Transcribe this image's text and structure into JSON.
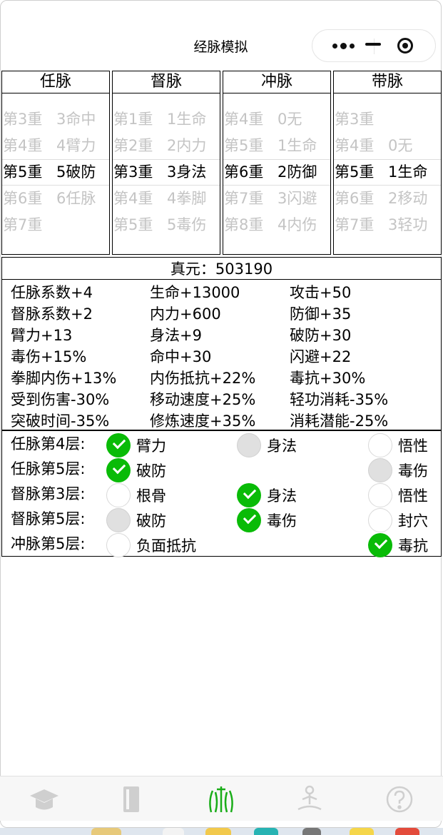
{
  "window": {
    "title": "经脉模拟"
  },
  "capsule": {
    "more_icon": "more-dots-icon",
    "minimize_icon": "minimize-icon",
    "close_icon": "target-close-icon"
  },
  "pickers": [
    {
      "name": "任脉",
      "rows": [
        {
          "lv": "第3重",
          "val": "3命中",
          "state": "dim"
        },
        {
          "lv": "第4重",
          "val": "4臂力",
          "state": "dim"
        },
        {
          "lv": "第5重",
          "val": "5破防",
          "state": "sel"
        },
        {
          "lv": "第6重",
          "val": "6任脉",
          "state": "dim"
        },
        {
          "lv": "第7重",
          "val": "",
          "state": "dim"
        }
      ]
    },
    {
      "name": "督脉",
      "rows": [
        {
          "lv": "第1重",
          "val": "1生命",
          "state": "dim"
        },
        {
          "lv": "第2重",
          "val": "2内力",
          "state": "dim"
        },
        {
          "lv": "第3重",
          "val": "3身法",
          "state": "sel"
        },
        {
          "lv": "第4重",
          "val": "4拳脚",
          "state": "dim"
        },
        {
          "lv": "第5重",
          "val": "5毒伤",
          "state": "dim"
        }
      ]
    },
    {
      "name": "冲脉",
      "rows": [
        {
          "lv": "第4重",
          "val": "0无",
          "state": "dim"
        },
        {
          "lv": "第5重",
          "val": "1生命",
          "state": "dim"
        },
        {
          "lv": "第6重",
          "val": "2防御",
          "state": "sel"
        },
        {
          "lv": "第7重",
          "val": "3闪避",
          "state": "dim"
        },
        {
          "lv": "第8重",
          "val": "4内伤",
          "state": "dim"
        }
      ]
    },
    {
      "name": "带脉",
      "rows": [
        {
          "lv": "第3重",
          "val": "",
          "state": "dim"
        },
        {
          "lv": "第4重",
          "val": "0无",
          "state": "dim"
        },
        {
          "lv": "第5重",
          "val": "1生命",
          "state": "sel"
        },
        {
          "lv": "第6重",
          "val": "2移动",
          "state": "dim"
        },
        {
          "lv": "第7重",
          "val": "3轻功",
          "state": "dim"
        }
      ]
    }
  ],
  "zhenyuan": {
    "text": "真元：503190"
  },
  "stats": [
    [
      "任脉系数+4",
      "生命+13000",
      "攻击+50"
    ],
    [
      "督脉系数+2",
      "内力+600",
      "防御+35"
    ],
    [
      "臂力+13",
      "身法+9",
      "破防+30"
    ],
    [
      "毒伤+15%",
      "命中+30",
      "闪避+22"
    ],
    [
      "拳脚内伤+13%",
      "内伤抵抗+22%",
      "毒抗+30%"
    ],
    [
      "受到伤害-30%",
      "移动速度+25%",
      "轻功消耗-35%"
    ],
    [
      "突破时间-35%",
      "修炼速度+35%",
      "消耗潜能-25%"
    ]
  ],
  "options": [
    {
      "label": "任脉第4层:",
      "choices": [
        {
          "name": "臂力",
          "state": "checked"
        },
        {
          "name": "身法",
          "state": "disabled"
        },
        {
          "name": "悟性",
          "state": "empty"
        }
      ]
    },
    {
      "label": "任脉第5层:",
      "choices": [
        {
          "name": "破防",
          "state": "checked"
        },
        {
          "name": "",
          "state": "none"
        },
        {
          "name": "毒伤",
          "state": "disabled"
        }
      ]
    },
    {
      "label": "督脉第3层:",
      "choices": [
        {
          "name": "根骨",
          "state": "empty"
        },
        {
          "name": "身法",
          "state": "checked"
        },
        {
          "name": "悟性",
          "state": "empty"
        }
      ]
    },
    {
      "label": "督脉第5层:",
      "choices": [
        {
          "name": "破防",
          "state": "disabled"
        },
        {
          "name": "毒伤",
          "state": "checked"
        },
        {
          "name": "封穴",
          "state": "empty"
        }
      ]
    },
    {
      "label": "冲脉第5层:",
      "choices": [
        {
          "name": "负面抵抗",
          "state": "empty"
        },
        {
          "name": "",
          "state": "none"
        },
        {
          "name": "毒抗",
          "state": "checked"
        }
      ]
    }
  ],
  "tabbar": {
    "tabs": [
      {
        "icon": "graduation-cap-icon",
        "active": false
      },
      {
        "icon": "book-icon",
        "active": false
      },
      {
        "icon": "meridian-body-icon",
        "active": true
      },
      {
        "icon": "meditation-icon",
        "active": false
      },
      {
        "icon": "help-icon",
        "active": false
      }
    ]
  },
  "colors": {
    "checked": "#09bb07",
    "disabled": "#e0e0e0",
    "active_tab": "#1aad19",
    "inactive_tab": "#cfcfcf"
  }
}
